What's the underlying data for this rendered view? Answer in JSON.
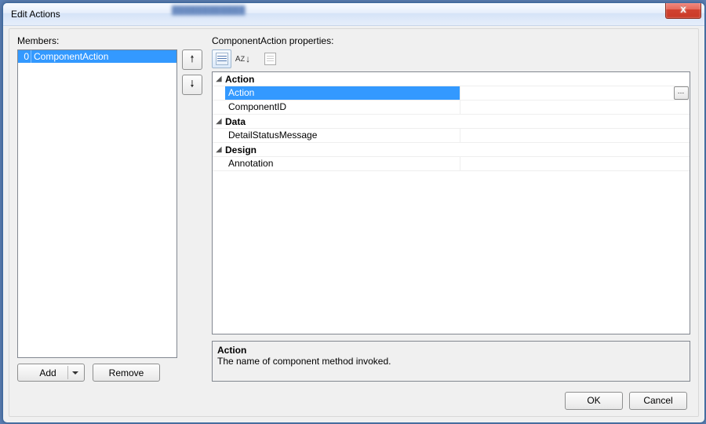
{
  "window": {
    "title": "Edit Actions"
  },
  "left": {
    "label": "Members:",
    "items": [
      {
        "index": "0",
        "name": "ComponentAction"
      }
    ],
    "add_label": "Add",
    "remove_label": "Remove"
  },
  "right": {
    "label": "ComponentAction properties:",
    "categories": [
      {
        "name": "Action",
        "props": [
          {
            "name": "Action",
            "value": "",
            "selected": true,
            "ellipsis": true
          },
          {
            "name": "ComponentID",
            "value": ""
          }
        ]
      },
      {
        "name": "Data",
        "props": [
          {
            "name": "DetailStatusMessage",
            "value": ""
          }
        ]
      },
      {
        "name": "Design",
        "props": [
          {
            "name": "Annotation",
            "value": ""
          }
        ]
      }
    ],
    "help": {
      "title": "Action",
      "desc": "The name of component method invoked."
    }
  },
  "footer": {
    "ok": "OK",
    "cancel": "Cancel"
  }
}
